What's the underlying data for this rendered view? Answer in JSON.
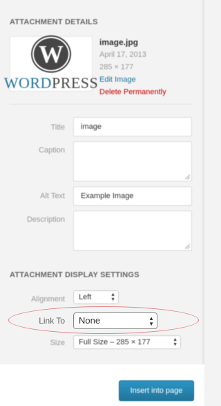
{
  "details": {
    "heading": "ATTACHMENT DETAILS",
    "thumbnail": {
      "logo_icon": "wordpress-logo-icon",
      "logo_text_word": "WORD",
      "logo_text_press": "PRESS"
    },
    "filename": "image.jpg",
    "date": "April 17, 2013",
    "dimensions": "285 × 177",
    "edit_link": "Edit Image",
    "delete_link": "Delete Permanently"
  },
  "fields": {
    "title_label": "Title",
    "title_value": "image",
    "caption_label": "Caption",
    "caption_value": "",
    "alt_label": "Alt Text",
    "alt_value": "Example Image",
    "description_label": "Description",
    "description_value": ""
  },
  "display": {
    "heading": "ATTACHMENT DISPLAY SETTINGS",
    "alignment_label": "Alignment",
    "alignment_value": "Left",
    "link_to_label": "Link To",
    "link_to_value": "None",
    "size_label": "Size",
    "size_value": "Full Size – 285 × 177"
  },
  "footer": {
    "insert_button": "Insert into page"
  },
  "colors": {
    "link": "#21759b",
    "danger": "#cc0000",
    "highlight_ellipse": "#e08585",
    "button": "#21759b"
  }
}
